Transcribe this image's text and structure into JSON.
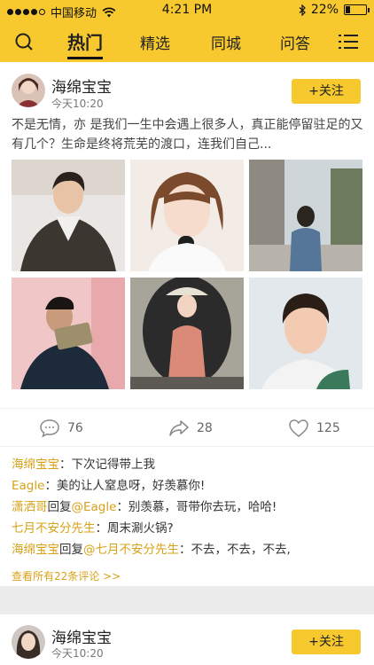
{
  "status_bar": {
    "carrier": "中国移动",
    "time": "4:21 PM",
    "battery": "22%",
    "battery_level": 0.22
  },
  "nav": {
    "tabs": [
      "热门",
      "精选",
      "同城",
      "问答"
    ],
    "active_tab": "热门",
    "search_icon": "search-icon",
    "menu_icon": "menu-icon"
  },
  "post": {
    "username": "海绵宝宝",
    "time": "今天10:20",
    "follow_label": "+关注",
    "text": "不是无情，亦 是我们一生中会遇上很多人，真正能停留驻足的又有几个？生命是终将荒芜的渡口，连我们自己...",
    "actions": {
      "comment_icon": "comment-bubble-icon",
      "comment_count": "76",
      "share_icon": "share-arrow-icon",
      "share_count": "28",
      "like_icon": "heart-icon",
      "like_count": "125"
    },
    "comments": [
      {
        "parts": [
          {
            "text": "海绵宝宝",
            "style": "name"
          },
          {
            "text": "：下次记得带上我",
            "style": "text"
          }
        ]
      },
      {
        "parts": [
          {
            "text": "Eagle",
            "style": "name"
          },
          {
            "text": "：美的让人窒息呀，好羡慕你!",
            "style": "text"
          }
        ]
      },
      {
        "parts": [
          {
            "text": "潇洒哥",
            "style": "name"
          },
          {
            "text": "回复",
            "style": "text"
          },
          {
            "text": "@Eagle",
            "style": "name"
          },
          {
            "text": "：别羡慕，哥带你去玩，哈哈!",
            "style": "text"
          }
        ]
      },
      {
        "parts": [
          {
            "text": "七月不安分先生",
            "style": "name"
          },
          {
            "text": "：周末涮火锅?",
            "style": "text"
          }
        ]
      },
      {
        "parts": [
          {
            "text": "海绵宝宝",
            "style": "name"
          },
          {
            "text": "回复",
            "style": "text"
          },
          {
            "text": "@七月不安分先生",
            "style": "name"
          },
          {
            "text": "：不去，不去，不去,",
            "style": "text"
          }
        ]
      }
    ],
    "more_comments": "查看所有22条评论 >>"
  },
  "post2": {
    "username": "海绵宝宝",
    "time": "今天10:20",
    "follow_label": "+关注"
  },
  "colors": {
    "brand": "#f8c92e",
    "name_link": "#d8a218"
  }
}
